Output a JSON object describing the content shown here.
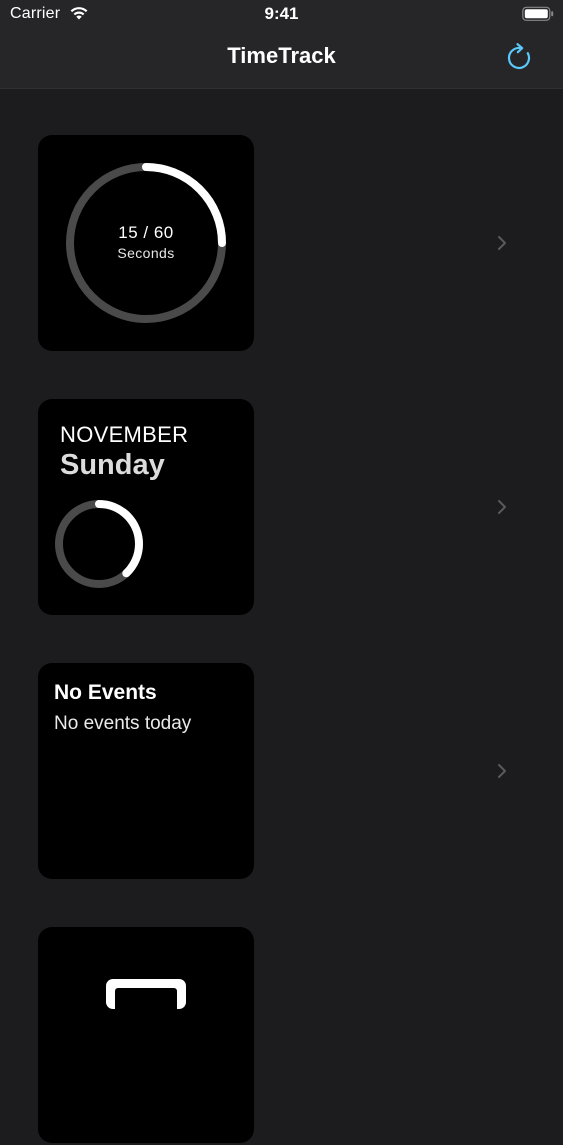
{
  "status_bar": {
    "carrier": "Carrier",
    "time": "9:41",
    "wifi_icon": "wifi-icon",
    "battery_icon": "battery-icon"
  },
  "nav": {
    "title": "TimeTrack",
    "refresh_icon": "refresh-icon",
    "accent_color": "#5ac8fa"
  },
  "rows": [
    {
      "widget": "seconds-ring",
      "count_text": "15 / 60",
      "unit_text": "Seconds",
      "progress": 0.25,
      "chevron_icon": "chevron-right-icon"
    },
    {
      "widget": "calendar-day",
      "month": "NOVEMBER",
      "day": "Sunday",
      "progress": 0.38,
      "chevron_icon": "chevron-right-icon"
    },
    {
      "widget": "events",
      "title": "No Events",
      "subtitle": "No events today",
      "chevron_icon": "chevron-right-icon"
    },
    {
      "widget": "partial",
      "icon": "tray-icon"
    }
  ],
  "colors": {
    "background": "#1c1c1e",
    "nav_background": "#262628",
    "card_background": "#000000",
    "ring_track": "#4a4a4a",
    "ring_progress": "#ffffff",
    "chevron": "#5a5a5c"
  }
}
